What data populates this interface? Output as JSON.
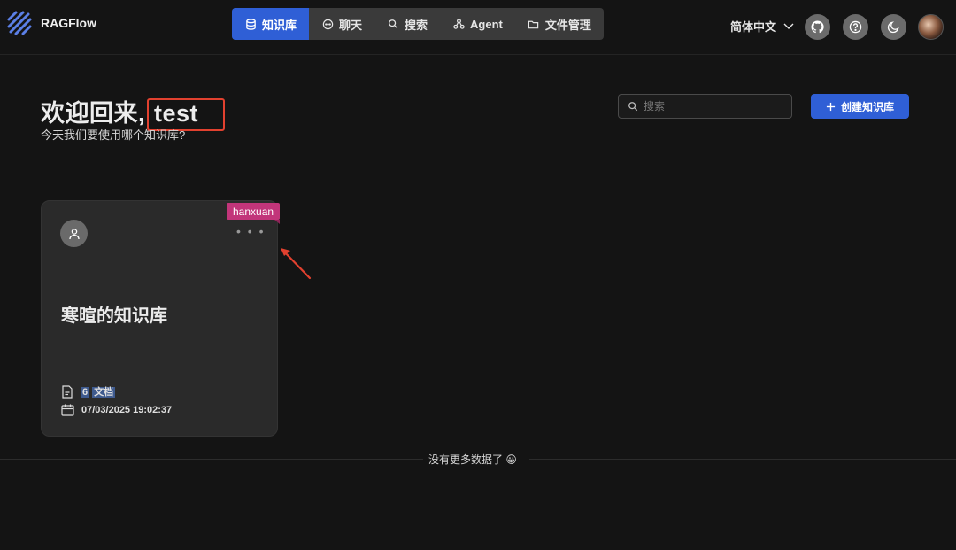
{
  "app": {
    "name": "RAGFlow"
  },
  "nav": {
    "items": [
      {
        "label": "知识库",
        "icon": "database-icon",
        "active": true
      },
      {
        "label": "聊天",
        "icon": "chat-icon",
        "active": false
      },
      {
        "label": "搜索",
        "icon": "search-icon",
        "active": false
      },
      {
        "label": "Agent",
        "icon": "agent-graph-icon",
        "active": false
      },
      {
        "label": "文件管理",
        "icon": "folder-icon",
        "active": false
      }
    ]
  },
  "header": {
    "language": "简体中文",
    "icons": [
      "github-icon",
      "help-icon",
      "moon-icon"
    ]
  },
  "welcome": {
    "greeting": "欢迎回来,",
    "username": "test",
    "subtitle": "今天我们要使用哪个知识库?"
  },
  "search": {
    "placeholder": "搜索"
  },
  "create_button": {
    "label": "创建知识库"
  },
  "knowledge_base": {
    "owner_tag": "hanxuan",
    "more": "• • •",
    "title": "寒暄的知识库",
    "doc_count": "6",
    "doc_unit": "文档",
    "created": "07/03/2025 19:02:37"
  },
  "footer": {
    "no_more": "没有更多数据了 😀"
  },
  "colors": {
    "accent": "#2f5fd6",
    "tag": "#c2357a",
    "highlight_box": "#e2412f"
  }
}
